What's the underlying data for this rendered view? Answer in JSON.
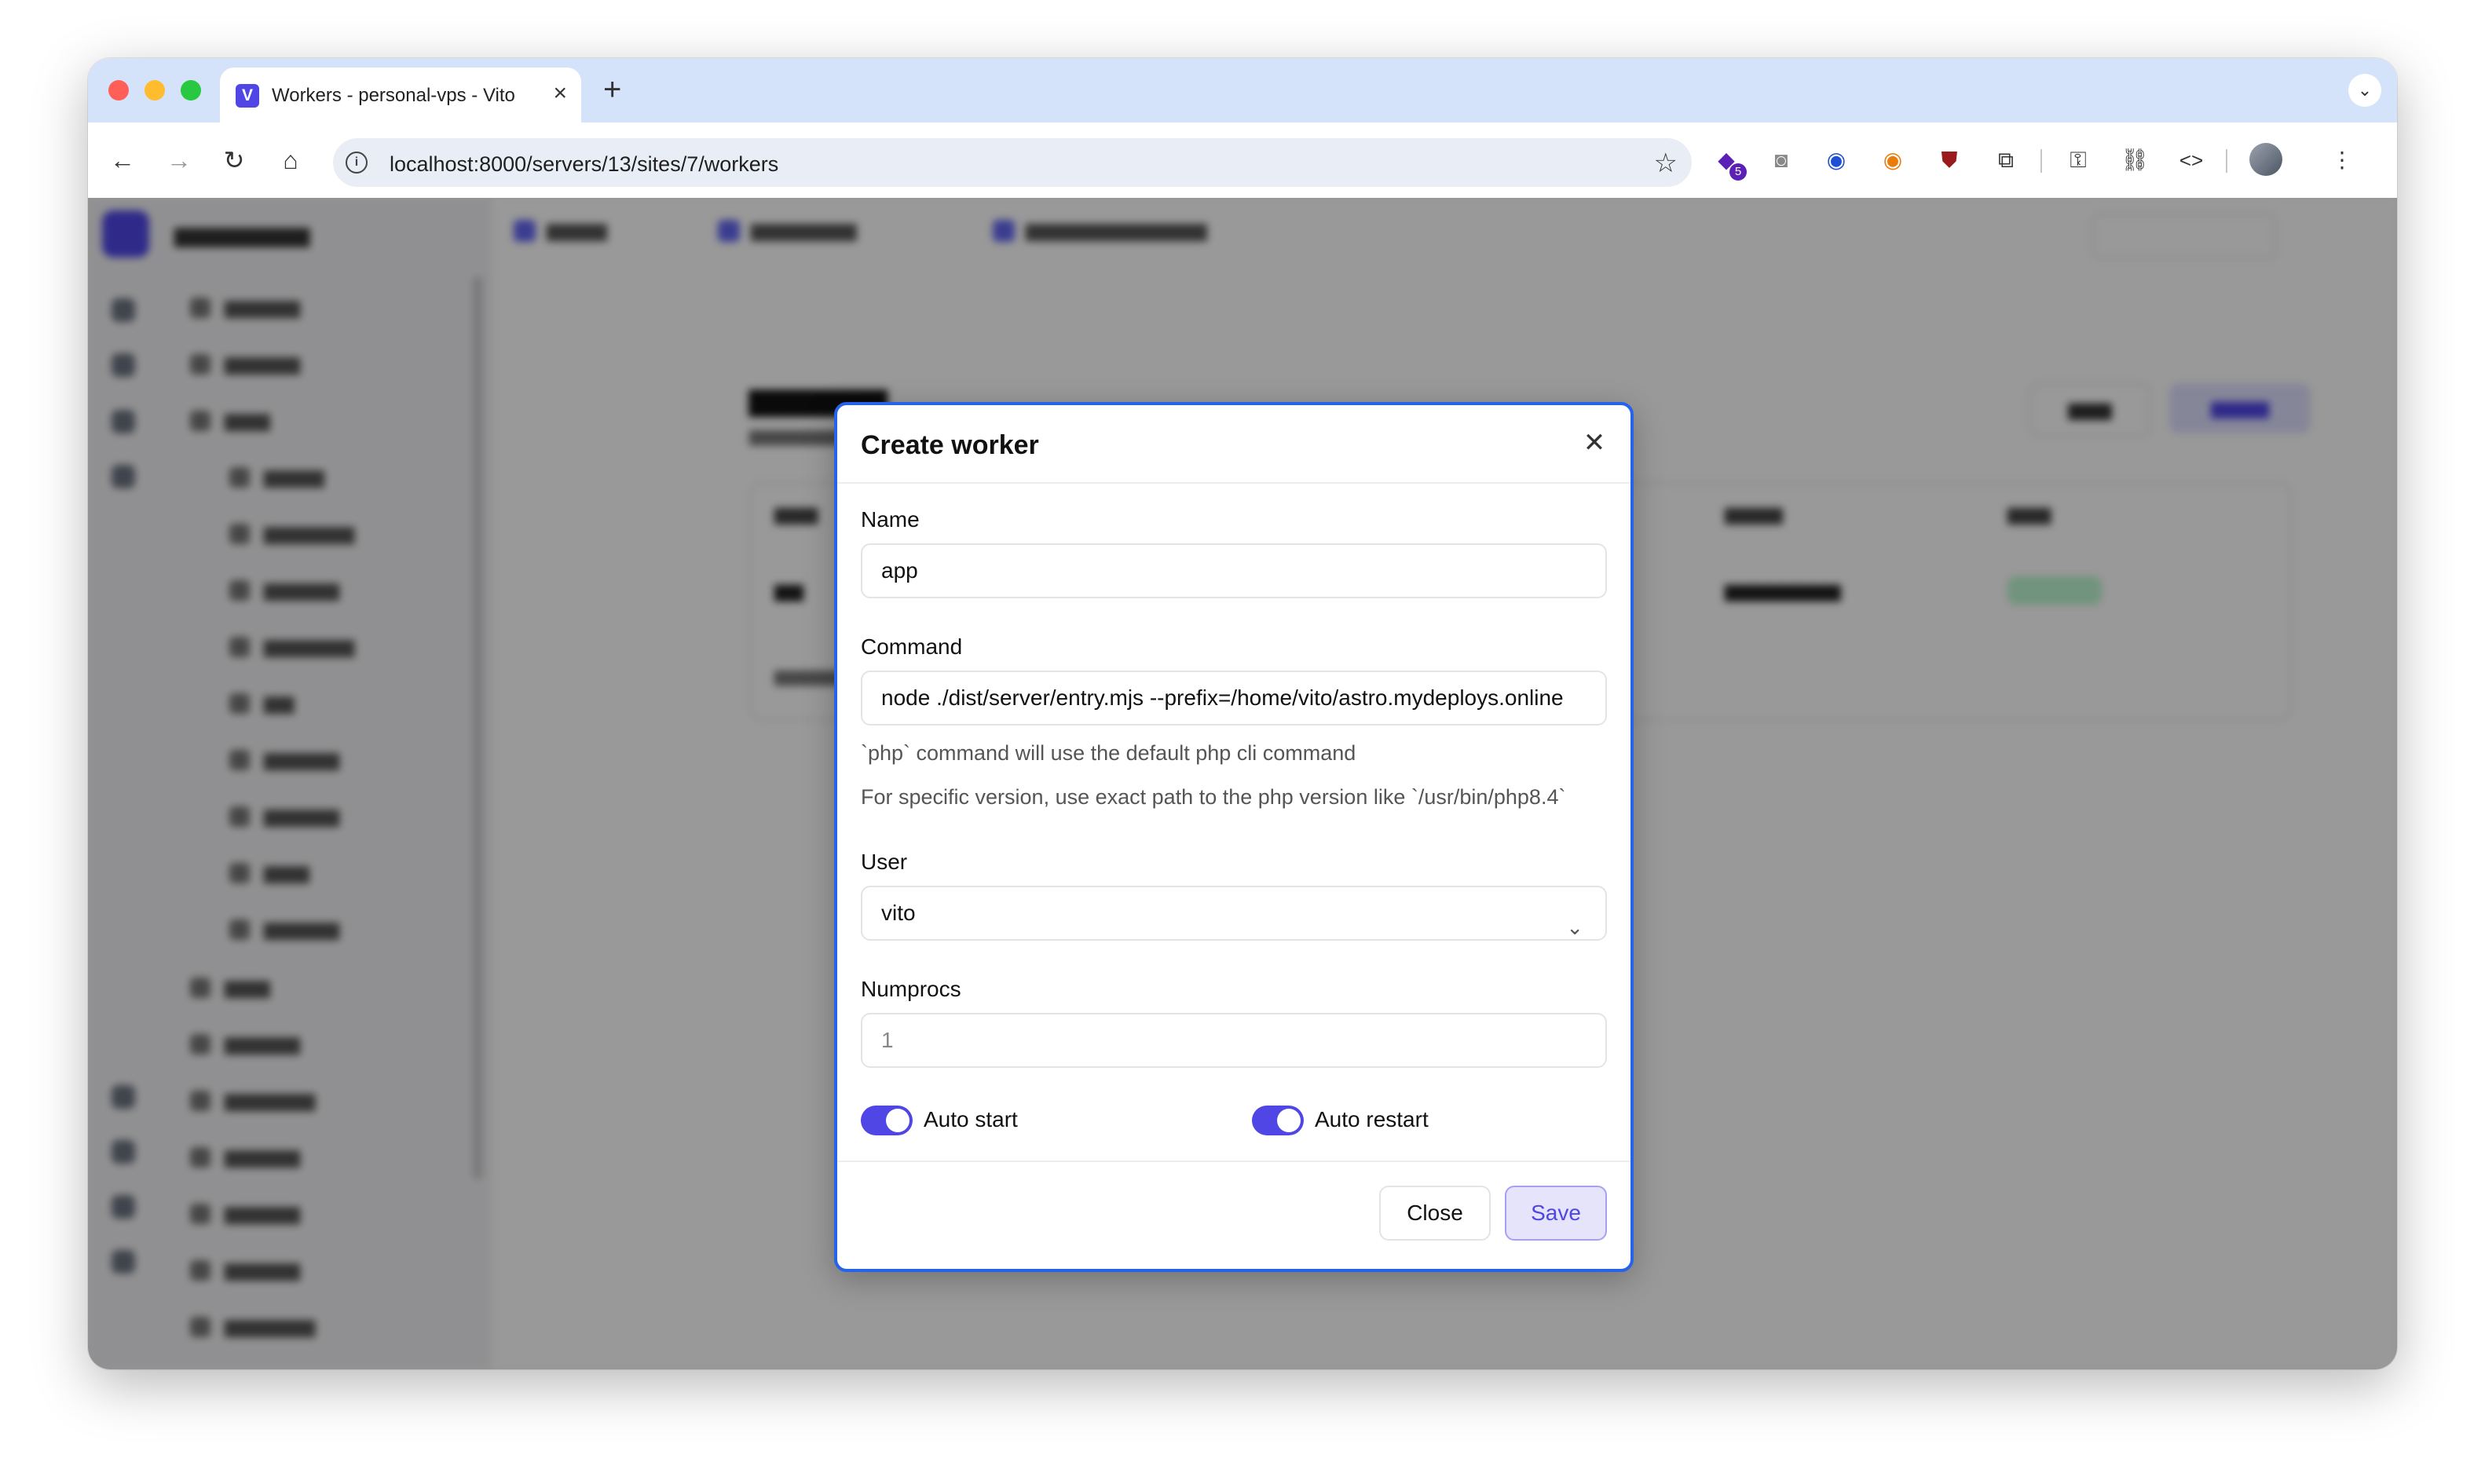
{
  "browser": {
    "tab_title": "Workers - personal-vps - Vito",
    "tab_favicon": "V",
    "url": "localhost:8000/servers/13/sites/7/workers",
    "extension_badge_count": "5"
  },
  "modal": {
    "title": "Create worker",
    "name_label": "Name",
    "name_value": "app",
    "command_label": "Command",
    "command_value": "node ./dist/server/entry.mjs --prefix=/home/vito/astro.mydeploys.online",
    "command_hint_1": "`php` command will use the default php cli command",
    "command_hint_2": "For specific version, use exact path to the php version like `/usr/bin/php8.4`",
    "user_label": "User",
    "user_value": "vito",
    "numprocs_label": "Numprocs",
    "numprocs_placeholder": "1",
    "auto_start_label": "Auto start",
    "auto_start": true,
    "auto_restart_label": "Auto restart",
    "auto_restart": true,
    "close_label": "Close",
    "save_label": "Save"
  },
  "colors": {
    "accent": "#4f46e5",
    "focus_ring": "#2563eb",
    "tabstrip": "#d5e3fa"
  }
}
